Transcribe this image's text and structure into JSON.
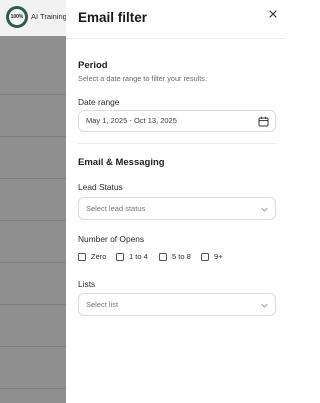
{
  "background": {
    "logo_text": "100%",
    "brand_name": "AI Training"
  },
  "drawer": {
    "title": "Email filter",
    "close_icon": "close-icon",
    "period": {
      "title": "Period",
      "description": "Select a date range to filter your results.",
      "date_range_label": "Date range",
      "date_range_value": "May 1, 2025 - Oct 13, 2025"
    },
    "messaging": {
      "title": "Email & Messaging",
      "lead_status_label": "Lead Status",
      "lead_status_placeholder": "Select lead status",
      "opens_label": "Number of Opens",
      "opens_options": [
        {
          "label": "Zero",
          "checked": false
        },
        {
          "label": "1 to 4",
          "checked": false
        },
        {
          "label": "5 to 8",
          "checked": false
        },
        {
          "label": "9+",
          "checked": false
        }
      ],
      "lists_label": "Lists",
      "lists_placeholder": "Select list"
    }
  },
  "colors": {
    "overlay": "#8f8f8f",
    "logo_ring": "#2b5e4f"
  }
}
